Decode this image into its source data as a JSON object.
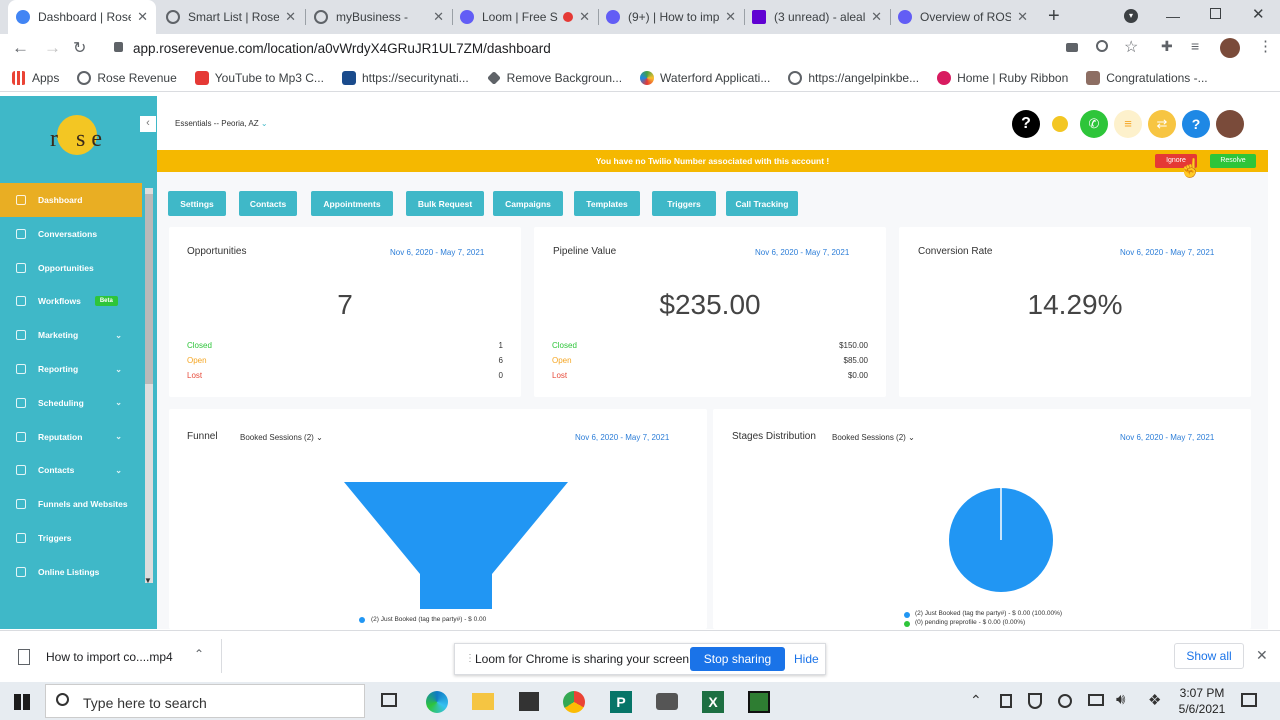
{
  "browser": {
    "tabs": [
      {
        "title": "Dashboard | Rose",
        "color": "#4285f4"
      },
      {
        "title": "Smart List | Rose I",
        "color": "#5f6368"
      },
      {
        "title": "myBusiness -",
        "color": "#5f6368"
      },
      {
        "title": "Loom | Free S",
        "color": "#625df5"
      },
      {
        "title": "(9+) | How to imp",
        "color": "#625df5"
      },
      {
        "title": "(3 unread) - aleal",
        "color": "#6001d2"
      },
      {
        "title": "Overview of ROSE",
        "color": "#625df5"
      }
    ],
    "url": "app.roserevenue.com/location/a0vWrdyX4GRuJR1UL7ZM/dashboard",
    "bookmarks": [
      {
        "label": "Apps",
        "color": "#ea4335"
      },
      {
        "label": "Rose Revenue",
        "color": "#5f6368"
      },
      {
        "label": "YouTube to Mp3 C...",
        "color": "#e53935"
      },
      {
        "label": "https://securitynati...",
        "color": "#1a4b8c"
      },
      {
        "label": "Remove Backgroun...",
        "color": "#5f6368"
      },
      {
        "label": "Waterford Applicati...",
        "color": "#43a047"
      },
      {
        "label": "https://angelpinkbe...",
        "color": "#5f6368"
      },
      {
        "label": "Home | Ruby Ribbon",
        "color": "#d81b60"
      },
      {
        "label": "Congratulations -...",
        "color": "#8d6e63"
      }
    ]
  },
  "app": {
    "location": "Essentials -- Peoria, AZ",
    "banner": {
      "text": "You have no Twilio Number associated with this account !",
      "ignore": "Ignore",
      "resolve": "Resolve"
    },
    "logo_text": "r   s e",
    "sidebar": [
      {
        "label": "Dashboard",
        "active": true
      },
      {
        "label": "Conversations"
      },
      {
        "label": "Opportunities"
      },
      {
        "label": "Workflows",
        "badge": "Beta"
      },
      {
        "label": "Marketing",
        "chev": true
      },
      {
        "label": "Reporting",
        "chev": true
      },
      {
        "label": "Scheduling",
        "chev": true
      },
      {
        "label": "Reputation",
        "chev": true
      },
      {
        "label": "Contacts",
        "chev": true
      },
      {
        "label": "Funnels and Websites"
      },
      {
        "label": "Triggers"
      },
      {
        "label": "Online Listings"
      }
    ],
    "nav_buttons": [
      "Settings",
      "Contacts",
      "Appointments",
      "Bulk Request",
      "Campaigns",
      "Templates",
      "Triggers",
      "Call Tracking"
    ],
    "cards": {
      "opportunities": {
        "title": "Opportunities",
        "date": "Nov 6, 2020 - May 7, 2021",
        "value": "7",
        "rows": [
          {
            "label": "Closed",
            "value": "1",
            "color": "#2ec53a"
          },
          {
            "label": "Open",
            "value": "6",
            "color": "#f5a623"
          },
          {
            "label": "Lost",
            "value": "0",
            "color": "#e74c3c"
          }
        ]
      },
      "pipeline": {
        "title": "Pipeline Value",
        "date": "Nov 6, 2020 - May 7, 2021",
        "value": "$235.00",
        "rows": [
          {
            "label": "Closed",
            "value": "$150.00",
            "color": "#2ec53a"
          },
          {
            "label": "Open",
            "value": "$85.00",
            "color": "#f5a623"
          },
          {
            "label": "Lost",
            "value": "$0.00",
            "color": "#e74c3c"
          }
        ]
      },
      "conversion": {
        "title": "Conversion Rate",
        "date": "Nov 6, 2020 - May 7, 2021",
        "value": "14.29%"
      }
    },
    "funnel": {
      "title": "Funnel",
      "filter": "Booked Sessions (2)",
      "date": "Nov 6, 2020 - May 7, 2021",
      "legend": "(2) Just Booked (tag the party#) - $ 0.00",
      "color": "#2196f3"
    },
    "stages": {
      "title": "Stages Distribution",
      "filter": "Booked Sessions (2)",
      "date": "Nov 6, 2020 - May 7, 2021",
      "legend": [
        {
          "label": "(2) Just Booked (tag the party#) - $ 0.00 (100.00%)",
          "color": "#2196f3"
        },
        {
          "label": "(0) pending preprofile - $ 0.00 (0.00%)",
          "color": "#2ec53a"
        }
      ]
    }
  },
  "download": {
    "file": "How to import co....mp4",
    "show_all": "Show all"
  },
  "share": {
    "text": "Loom for Chrome is sharing your screen.",
    "stop": "Stop sharing",
    "hide": "Hide"
  },
  "taskbar": {
    "search": "Type here to search",
    "time": "3:07 PM",
    "date": "5/6/2021"
  }
}
